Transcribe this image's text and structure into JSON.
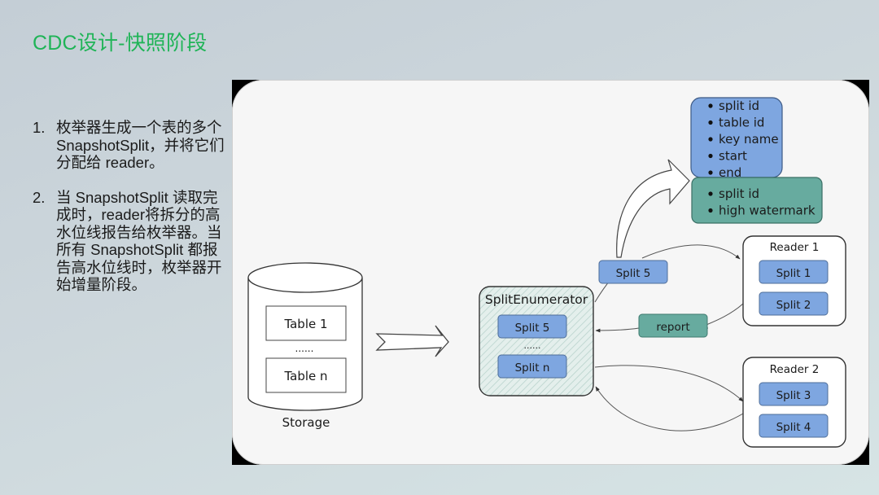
{
  "slide": {
    "title": "CDC设计-快照阶段",
    "bullets": [
      {
        "num": "1.",
        "text": "枚举器生成一个表的多个 SnapshotSplit，并将它们分配给 reader。"
      },
      {
        "num": "2.",
        "text": "当 SnapshotSplit 读取完成时，reader将拆分的高水位线报告给枚举器。当所有 SnapshotSplit 都报告高水位线时，枚举器开始增量阶段。"
      }
    ]
  },
  "diagram": {
    "storage": {
      "label": "Storage",
      "tables": [
        "Table 1",
        "Table n"
      ],
      "ellipsis": "......"
    },
    "enumerator": {
      "label": "SplitEnumerator",
      "splits": [
        "Split 5",
        "Split n"
      ],
      "ellipsis": "......"
    },
    "assign_split": "Split 5",
    "report": "report",
    "split_fields": [
      "split id",
      "table id",
      "key name",
      "start",
      "end"
    ],
    "report_fields": [
      "split id",
      "high watermark"
    ],
    "readers": [
      {
        "label": "Reader 1",
        "splits": [
          "Split 1",
          "Split 2"
        ]
      },
      {
        "label": "Reader 2",
        "splits": [
          "Split 3",
          "Split 4"
        ]
      }
    ],
    "colors": {
      "split_blue": "#7ea6e0",
      "report_green": "#67ab9f",
      "enumerator_fill": "#dde9e6",
      "title_green": "#1fb457"
    }
  }
}
